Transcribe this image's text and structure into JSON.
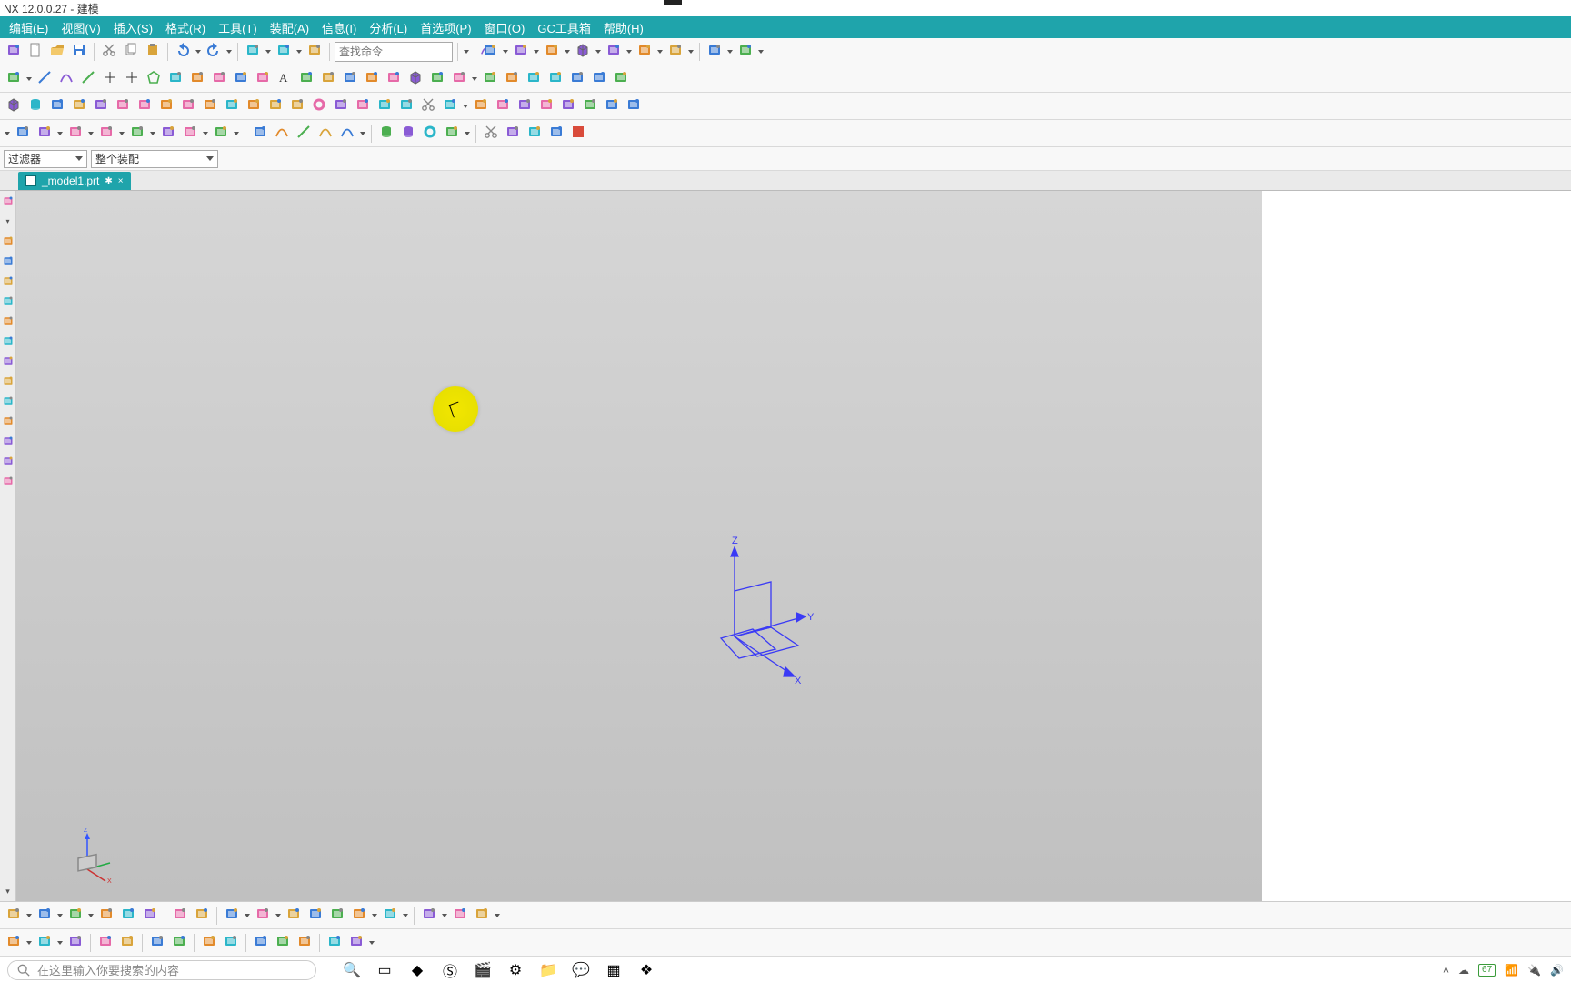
{
  "title": "NX 12.0.0.27 - 建模",
  "menu": [
    "编辑(E)",
    "视图(V)",
    "插入(S)",
    "格式(R)",
    "工具(T)",
    "装配(A)",
    "信息(I)",
    "分析(L)",
    "首选项(P)",
    "窗口(O)",
    "GC工具箱",
    "帮助(H)"
  ],
  "search_placeholder": "查找命令",
  "filter_combo1": "过滤器",
  "filter_combo2": "整个装配",
  "tab": {
    "label": "_model1.prt",
    "dirty": "✱",
    "close": "×"
  },
  "csys_labels": {
    "x": "X",
    "y": "Y",
    "z": "Z"
  },
  "taskbar": {
    "search_placeholder": "在这里输入你要搜索的内容",
    "battery": "67"
  },
  "toolbar1_icons": [
    "start-dd",
    "new-file",
    "open",
    "save",
    "sep",
    "cut",
    "copy",
    "paste",
    "sep",
    "undo",
    "dd",
    "redo",
    "dd",
    "sep",
    "sheet",
    "dd",
    "square",
    "dd",
    "layer-settings",
    "sep",
    "search",
    "sep",
    "dd",
    "sep",
    "render-sel",
    "dd",
    "fit",
    "dd",
    "wireframe",
    "dd",
    "cube",
    "dd",
    "clip",
    "dd",
    "hide",
    "dd",
    "face",
    "dd",
    "sep",
    "window",
    "dd",
    "assembly",
    "dd"
  ],
  "toolbar2_icons": [
    "sketch",
    "dd",
    "line",
    "arc",
    "spline",
    "point",
    "ex-point",
    "polygon",
    "trim",
    "fillet",
    "tangent",
    "sphere",
    "sweep",
    "text",
    "cloud",
    "chamfer",
    "project",
    "surface",
    "shade",
    "bbox",
    "feature",
    "insert",
    "dd",
    "blue1",
    "blue2",
    "gold",
    "dash",
    "ruler-v",
    "ruler-h",
    "measure"
  ],
  "toolbar3_icons": [
    "box",
    "cyl",
    "cone",
    "block",
    "rev",
    "gold-dd",
    "extrude",
    "shell",
    "pad",
    "plate",
    "loft",
    "screw",
    "helix",
    "coil",
    "spring",
    "pin",
    "flange",
    "rib",
    "slot",
    "cut",
    "hole",
    "dd",
    "pink",
    "gold2",
    "green-dd",
    "ruler",
    "cross",
    "clip2",
    "magenta",
    "green2"
  ],
  "toolbar4_icons": [
    "dd",
    "x",
    "extrude-ex",
    "dd",
    "pocket",
    "dd",
    "sweep2",
    "dd",
    "tube",
    "dd",
    "mold",
    "insert",
    "dd",
    "measure-body",
    "dd",
    "sep",
    "wrap",
    "curve",
    "spline2",
    "trim-curve",
    "curve2",
    "dd",
    "sep",
    "cyl-rod",
    "pill",
    "ring",
    "brush",
    "dd",
    "sep",
    "cut-plane",
    "edge",
    "dotted",
    "detect",
    "stop"
  ],
  "filter_icons": [
    "arrow",
    "dd",
    "sel",
    "dd",
    "back",
    "sep",
    "pick",
    "rect",
    "dd",
    "sel2",
    "show",
    "sep",
    "f1",
    "f2",
    "f3",
    "f4",
    "f5",
    "f6",
    "f7",
    "f8",
    "f9",
    "f10",
    "sep",
    "f11",
    "f12",
    "f13",
    "sep",
    "f14"
  ],
  "side_icons": [
    "nav",
    "dd",
    "feat",
    "part",
    "layer",
    "sheet",
    "tool1",
    "tool2",
    "tool3",
    "hist",
    "sel",
    "more",
    "clip",
    "op1",
    "op2"
  ],
  "bottom1_icons": [
    "b1",
    "dd",
    "b2",
    "dd",
    "b3",
    "dd",
    "b4",
    "b5",
    "b6",
    "sep",
    "b7",
    "b8",
    "sep",
    "b9",
    "dd",
    "b10",
    "dd",
    "b11",
    "b12",
    "b13",
    "b14",
    "dd",
    "b15",
    "dd",
    "sep",
    "b16",
    "dd",
    "b17",
    "b18",
    "dd"
  ],
  "bottom2_icons": [
    "c1",
    "dd",
    "c2",
    "dd",
    "c3",
    "sep",
    "c4",
    "c5",
    "sep",
    "c6",
    "c7",
    "sep",
    "c8",
    "c9",
    "sep",
    "c10",
    "c11",
    "c12",
    "sep",
    "c13",
    "c14",
    "dd"
  ],
  "task_icons": [
    "search",
    "taskview",
    "edge",
    "skype",
    "video",
    "settings",
    "files",
    "wechat",
    "app1",
    "app2"
  ],
  "tray_icons": [
    "up",
    "cloud",
    "wifi",
    "mic",
    "battery",
    "sound"
  ]
}
